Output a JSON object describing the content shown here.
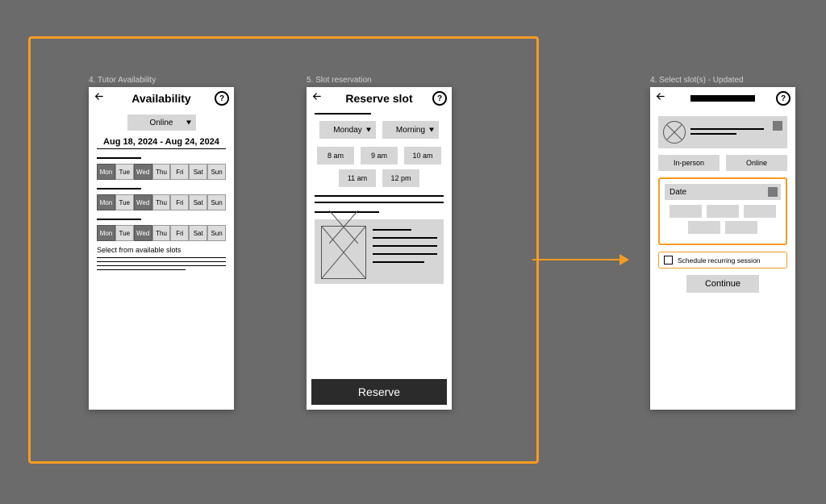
{
  "captions": {
    "s1": "4. Tutor Availability",
    "s2": "5. Slot reservation",
    "s3": "4. Select slot(s) - Updated"
  },
  "screen1": {
    "title": "Availability",
    "mode": "Online",
    "range": "Aug 18, 2024 - Aug 24, 2024",
    "days": [
      "Mon",
      "Tue",
      "Wed",
      "Thu",
      "Fri",
      "Sat",
      "Sun"
    ],
    "note": "Select from available slots"
  },
  "screen2": {
    "title": "Reserve slot",
    "daySel": "Monday",
    "partSel": "Morning",
    "times1": [
      "8 am",
      "9 am",
      "10 am"
    ],
    "times2": [
      "11 am",
      "12 pm"
    ],
    "cta": "Reserve"
  },
  "screen3": {
    "modes": {
      "a": "In-person",
      "b": "Online"
    },
    "dateLabel": "Date",
    "recurring": "Schedule recurring session",
    "cta": "Continue"
  }
}
